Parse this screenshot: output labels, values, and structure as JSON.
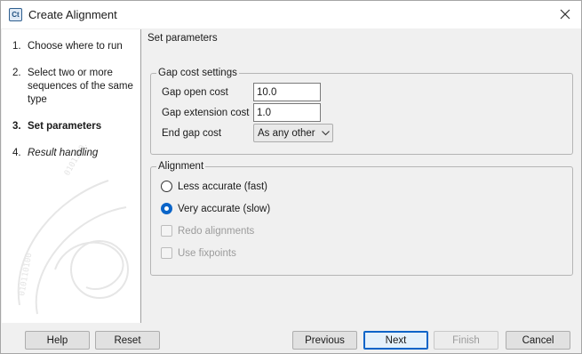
{
  "window": {
    "title": "Create Alignment",
    "icon_text": "Ct"
  },
  "steps": [
    {
      "num": "1.",
      "label": "Choose where to run",
      "state": "done"
    },
    {
      "num": "2.",
      "label": "Select two or more sequences of the same type",
      "state": "done"
    },
    {
      "num": "3.",
      "label": "Set parameters",
      "state": "active"
    },
    {
      "num": "4.",
      "label": "Result handling",
      "state": "future"
    }
  ],
  "page": {
    "title": "Set parameters",
    "gap_cost": {
      "legend": "Gap cost settings",
      "gap_open_label": "Gap open cost",
      "gap_open_value": "10.0",
      "gap_extension_label": "Gap extension cost",
      "gap_extension_value": "1.0",
      "end_gap_label": "End gap cost",
      "end_gap_value": "As any other"
    },
    "alignment": {
      "legend": "Alignment",
      "less_accurate_label": "Less accurate (fast)",
      "very_accurate_label": "Very accurate (slow)",
      "selected": "very_accurate",
      "redo_label": "Redo alignments",
      "fixpoints_label": "Use fixpoints"
    }
  },
  "footer": {
    "help": "Help",
    "reset": "Reset",
    "previous": "Previous",
    "next": "Next",
    "finish": "Finish",
    "cancel": "Cancel"
  },
  "colors": {
    "accent": "#0a64c8",
    "disabled_text": "#9c9c9c"
  }
}
